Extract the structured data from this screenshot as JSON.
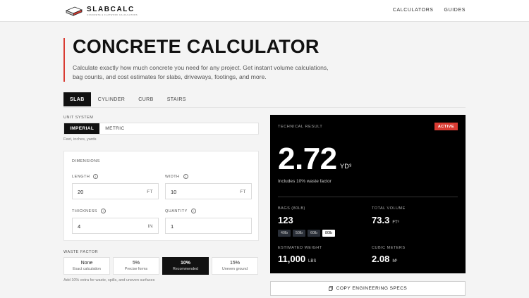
{
  "header": {
    "logo_name": "SLABCALC",
    "logo_tag": "CONCRETE & FLATWORK CALCULATORS",
    "nav": [
      "CALCULATORS",
      "GUIDES"
    ]
  },
  "hero": {
    "title": "CONCRETE CALCULATOR",
    "description": "Calculate exactly how much concrete you need for any project. Get instant volume calculations, bag counts, and cost estimates for slabs, driveways, footings, and more."
  },
  "tabs": [
    "SLAB",
    "CYLINDER",
    "CURB",
    "STAIRS"
  ],
  "unit_system": {
    "label": "UNIT SYSTEM",
    "options": [
      "IMPERIAL",
      "METRIC"
    ],
    "hint": "Feet, inches, yards"
  },
  "dimensions": {
    "title": "DIMENSIONS",
    "length": {
      "label": "LENGTH",
      "value": "20",
      "unit": "FT"
    },
    "width": {
      "label": "WIDTH",
      "value": "10",
      "unit": "FT"
    },
    "thickness": {
      "label": "THICKNESS",
      "value": "4",
      "unit": "IN"
    },
    "quantity": {
      "label": "QUANTITY",
      "value": "1"
    }
  },
  "waste": {
    "label": "WASTE FACTOR",
    "options": [
      {
        "value": "None",
        "sub": "Exact calculation"
      },
      {
        "value": "5%",
        "sub": "Precise forms"
      },
      {
        "value": "10%",
        "sub": "Recommended"
      },
      {
        "value": "15%",
        "sub": "Uneven ground"
      }
    ],
    "hint": "Add 10% extra for waste, spills, and uneven surfaces"
  },
  "result": {
    "label": "TECHNICAL RESULT",
    "badge": "ACTIVE",
    "value": "2.72",
    "unit": "YD³",
    "includes": "Includes 10% waste factor",
    "bags_label": "BAGS (80LB)",
    "bags_value": "123",
    "bag_sizes": [
      "40lb",
      "50lb",
      "60lb",
      "80lb"
    ],
    "total_volume_label": "TOTAL VOLUME",
    "total_volume_value": "73.3",
    "total_volume_unit": "FT³",
    "weight_label": "ESTIMATED WEIGHT",
    "weight_value": "11,000",
    "weight_unit": "LBS",
    "cubic_m_label": "CUBIC METERS",
    "cubic_m_value": "2.08",
    "cubic_m_unit": "M³"
  },
  "copy_button": "COPY ENGINEERING SPECS",
  "colors": {
    "accent": "#d93b32",
    "dark": "#111111"
  }
}
